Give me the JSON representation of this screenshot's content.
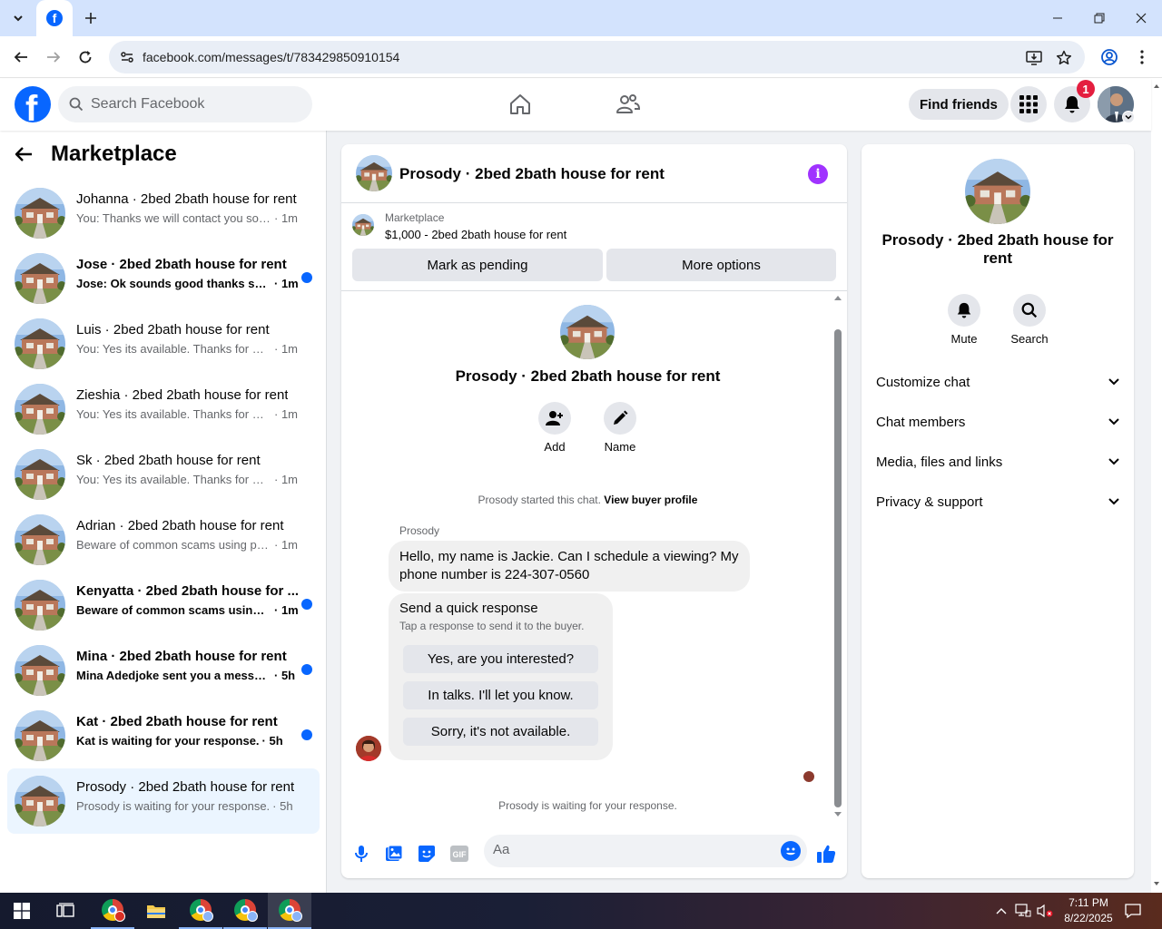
{
  "browser": {
    "url": "facebook.com/messages/t/783429850910154",
    "colors": {
      "tabstrip": "#d3e3fd",
      "omnibox": "#e9eef6"
    }
  },
  "header": {
    "search_placeholder": "Search Facebook",
    "find_friends_label": "Find friends",
    "notification_count": "1",
    "colors": {
      "brand": "#0866ff",
      "badge": "#e41e3f"
    }
  },
  "sidebar": {
    "title": "Marketplace",
    "conversations": [
      {
        "name": "Johanna · 2bed 2bath house for rent",
        "preview": "You: Thanks we will contact you soon!",
        "time": "· 1m",
        "unread": false
      },
      {
        "name": "Jose · 2bed 2bath house for rent",
        "preview": "Jose: Ok sounds good thanks so ...",
        "time": "· 1m",
        "unread": true
      },
      {
        "name": "Luis · 2bed 2bath house for rent",
        "preview": "You: Yes its available. Thanks for mess...",
        "time": "· 1m",
        "unread": false
      },
      {
        "name": "Zieshia · 2bed 2bath house for rent",
        "preview": "You: Yes its available. Thanks for mess...",
        "time": "· 1m",
        "unread": false
      },
      {
        "name": "Sk · 2bed 2bath house for rent",
        "preview": "You: Yes its available. Thanks for mess...",
        "time": "· 1m",
        "unread": false
      },
      {
        "name": "Adrian · 2bed 2bath house for rent",
        "preview": "Beware of common scams using pay...",
        "time": "· 1m",
        "unread": false
      },
      {
        "name": "Kenyatta · 2bed 2bath house for ...",
        "preview": "Beware of common scams using p...",
        "time": "· 1m",
        "unread": true
      },
      {
        "name": "Mina · 2bed 2bath house for rent",
        "preview": "Mina Adedjoke sent you a messag...",
        "time": "· 5h",
        "unread": true
      },
      {
        "name": "Kat · 2bed 2bath house for rent",
        "preview": "Kat is waiting for your response.",
        "time": "· 5h",
        "unread": true
      },
      {
        "name": "Prosody · 2bed 2bath house for rent",
        "preview": "Prosody is waiting for your response.",
        "time": "· 5h",
        "unread": false,
        "active": true
      }
    ]
  },
  "chat": {
    "title": "Prosody · 2bed 2bath house for rent",
    "listing": {
      "label": "Marketplace",
      "price_line": "$1,000 - 2bed 2bath house for rent",
      "mark_pending_label": "Mark as pending",
      "more_options_label": "More options"
    },
    "intro": {
      "title": "Prosody · 2bed 2bath house for rent",
      "add_label": "Add",
      "name_label": "Name",
      "started_text": "Prosody started this chat.",
      "view_profile_label": "View buyer profile"
    },
    "message": {
      "sender": "Prosody",
      "text": "Hello, my name is Jackie. Can I schedule a viewing? My phone number is 224-307-0560"
    },
    "quick_response": {
      "title": "Send a quick response",
      "subtitle": "Tap a response to send it to the buyer.",
      "options": [
        "Yes, are you interested?",
        "In talks. I'll let you know.",
        "Sorry, it's not available."
      ]
    },
    "waiting_text": "Prosody is waiting for your response.",
    "composer_placeholder": "Aa",
    "composer_icons": [
      "microphone-icon",
      "photo-icon",
      "sticker-icon",
      "gif-icon"
    ],
    "colors": {
      "accent": "#0866ff",
      "info": "#a033ff"
    }
  },
  "info_panel": {
    "title": "Prosody · 2bed 2bath house for rent",
    "mute_label": "Mute",
    "search_label": "Search",
    "sections": [
      "Customize chat",
      "Chat members",
      "Media, files and links",
      "Privacy & support"
    ]
  },
  "taskbar": {
    "time": "7:11 PM",
    "date": "8/22/2025"
  }
}
